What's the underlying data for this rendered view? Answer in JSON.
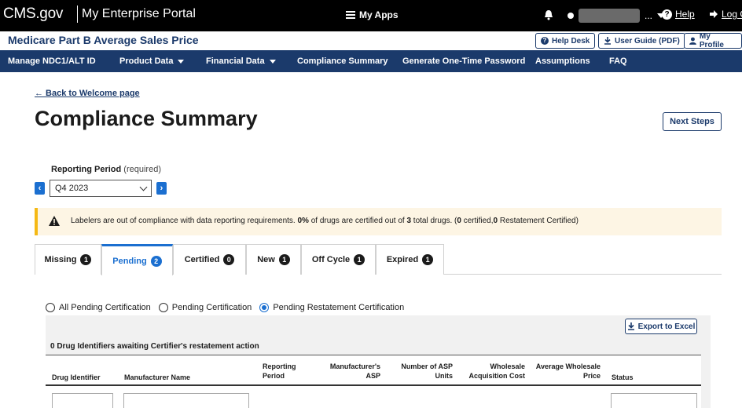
{
  "topbar": {
    "brand": "CMS.gov",
    "portal": "My Enterprise Portal",
    "my_apps": "My Apps",
    "user_ellipsis": "...",
    "help": "Help",
    "logout": "Log Out"
  },
  "app": {
    "title": "Medicare Part B Average Sales Price",
    "help_desk": "Help Desk",
    "user_guide": "User Guide (PDF)",
    "my_profile": "My Profile"
  },
  "nav": [
    {
      "label": "Manage NDC1/ALT ID"
    },
    {
      "label": "Product Data"
    },
    {
      "label": "Financial Data"
    },
    {
      "label": "Compliance Summary"
    },
    {
      "label": "Generate One-Time Password"
    },
    {
      "label": "Assumptions"
    },
    {
      "label": "FAQ"
    }
  ],
  "main": {
    "back_link": "← Back to Welcome page",
    "title": "Compliance Summary",
    "next_steps": "Next Steps",
    "reporting_period_label": "Reporting Period",
    "reporting_period_required": "(required)",
    "reporting_period_value": "Q4 2023",
    "prev_arrow": "‹",
    "next_arrow": "›"
  },
  "alert": {
    "part1": "Labelers are out of compliance with data reporting requirements. ",
    "pct": "0%",
    "part2": " of drugs are certified out of ",
    "total": "3",
    "part3": " total drugs. (",
    "certified": "0",
    "part4": " certified,",
    "restated": "0",
    "part5": " Restatement Certified)"
  },
  "tabs": [
    {
      "label": "Missing",
      "count": "1"
    },
    {
      "label": "Pending",
      "count": "2"
    },
    {
      "label": "Certified",
      "count": "0"
    },
    {
      "label": "New",
      "count": "1"
    },
    {
      "label": "Off Cycle",
      "count": "1"
    },
    {
      "label": "Expired",
      "count": "1"
    }
  ],
  "radios": [
    {
      "label": "All Pending Certification",
      "selected": false
    },
    {
      "label": "Pending Certification",
      "selected": false
    },
    {
      "label": "Pending Restatement Certification",
      "selected": true
    }
  ],
  "table": {
    "export": "Export to Excel",
    "awaiting": "0 Drug Identifiers awaiting Certifier's restatement action",
    "headers": {
      "drug_identifier": "Drug Identifier",
      "manufacturer_name": "Manufacturer Name",
      "reporting_period_1": "Reporting",
      "reporting_period_2": "Period",
      "mfr_asp_1": "Manufacturer's",
      "mfr_asp_2": "ASP",
      "asp_units_1": "Number of ASP",
      "asp_units_2": "Units",
      "wac_1": "Wholesale",
      "wac_2": "Acquisition Cost",
      "awp_1": "Average Wholesale",
      "awp_2": "Price",
      "status": "Status"
    }
  },
  "colors": {
    "navy": "#1b3a6b",
    "blue": "#1b6fd0",
    "alert_bg": "#fdf5e4",
    "alert_border": "#f5b915"
  }
}
